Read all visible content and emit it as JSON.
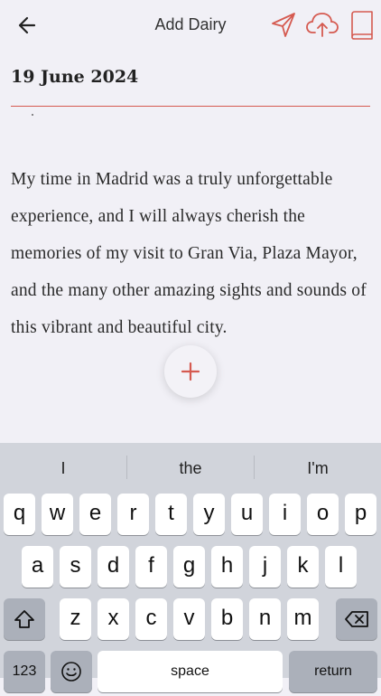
{
  "header": {
    "title": "Add Dairy",
    "accent": "#d55a50"
  },
  "entry": {
    "date": "19 June 2024",
    "text": "My time in Madrid was a truly unforgettable experience, and I will always cherish the memories of my visit to Gran Via, Plaza Mayor, and the many other amazing sights and sounds of this vibrant and beautiful city."
  },
  "keyboard": {
    "suggestions": [
      "I",
      "the",
      "I'm"
    ],
    "row1": [
      "q",
      "w",
      "e",
      "r",
      "t",
      "y",
      "u",
      "i",
      "o",
      "p"
    ],
    "row2": [
      "a",
      "s",
      "d",
      "f",
      "g",
      "h",
      "j",
      "k",
      "l"
    ],
    "row3": [
      "z",
      "x",
      "c",
      "v",
      "b",
      "n",
      "m"
    ],
    "numbers_label": "123",
    "space_label": "space",
    "return_label": "return"
  }
}
